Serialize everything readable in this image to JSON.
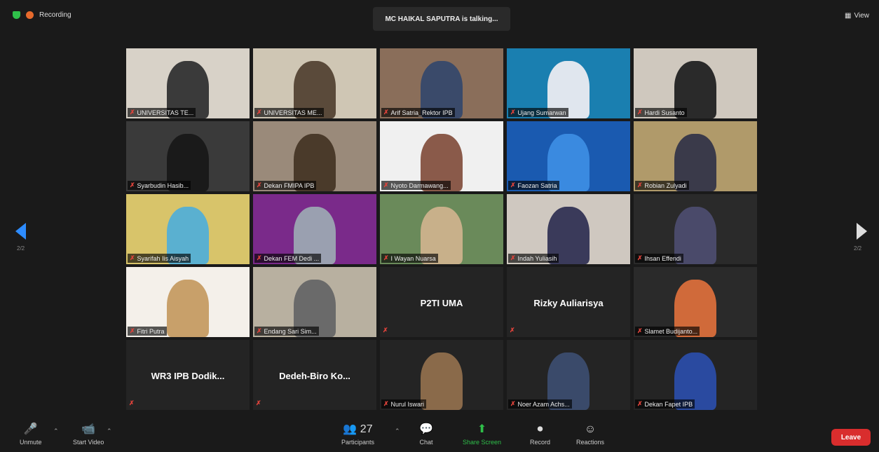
{
  "top": {
    "recording": "Recording",
    "talking": "MC HAIKAL SAPUTRA is talking...",
    "view": "View"
  },
  "page_indicator": {
    "left": "2/2",
    "right": "2/2"
  },
  "tiles": [
    {
      "name": "UNIVERSITAS TE...",
      "bg": "#d8d2c8",
      "fg": "#3a3a3a"
    },
    {
      "name": "UNIVERSITAS ME...",
      "bg": "#cfc6b4",
      "fg": "#5a4a3a"
    },
    {
      "name": "Arif Satria_Rektor IPB",
      "bg": "#8a6e5a",
      "fg": "#3a4a6a"
    },
    {
      "name": "Ujang Sumarwan",
      "bg": "#1a7fb0",
      "fg": "#e0e6ee"
    },
    {
      "name": "Hardi Susanto",
      "bg": "#cfc8be",
      "fg": "#2a2a2a"
    },
    {
      "name": "Syarbudin Hasib...",
      "bg": "#3a3a3a",
      "fg": "#1a1a1a"
    },
    {
      "name": "Dekan FMIPA IPB",
      "bg": "#9a8a7a",
      "fg": "#4a3a2a"
    },
    {
      "name": "Nyoto Darmawang...",
      "bg": "#f0f0f0",
      "fg": "#8a5a4a"
    },
    {
      "name": "Faozan Satria",
      "bg": "#1a5ab0",
      "fg": "#3a8ae0"
    },
    {
      "name": "Robian Zulyadi",
      "bg": "#b09a6a",
      "fg": "#3a3a4a"
    },
    {
      "name": "Syarifah Iis Aisyah",
      "bg": "#d8c46a",
      "fg": "#5ab0d0"
    },
    {
      "name": "Dekan FEM Dedi ...",
      "bg": "#7a2a8a",
      "fg": "#9aa0b0"
    },
    {
      "name": "I Wayan Nuarsa",
      "bg": "#6a8a5a",
      "fg": "#c8b08a"
    },
    {
      "name": "Indah Yuliasih",
      "bg": "#cfc8c0",
      "fg": "#3a3a5a"
    },
    {
      "name": "Ihsan Effendi",
      "bg": "#2a2a2a",
      "fg": "#4a4a6a"
    },
    {
      "name": "Fitri Putra",
      "bg": "#f4f0ea",
      "fg": "#c8a06a"
    },
    {
      "name": "Endang Sari Sim...",
      "bg": "#b8b0a0",
      "fg": "#6a6a6a"
    },
    {
      "name": "P2TI UMA",
      "big": true
    },
    {
      "name": "Rizky Auliarisya",
      "big": true
    },
    {
      "name": "Slamet Budijanto...",
      "bg": "#2a2a2a",
      "fg": "#d06a3a"
    },
    {
      "name": "WR3 IPB Dodik...",
      "big": true
    },
    {
      "name": "Dedeh-Biro Ko...",
      "big": true
    },
    {
      "name": "Nurul Iswari",
      "bg": "#242424",
      "fg": "#8a6a4a"
    },
    {
      "name": "Noer Azam Achs...",
      "bg": "#242424",
      "fg": "#3a4a6a"
    },
    {
      "name": "Dekan Fapet IPB",
      "bg": "#242424",
      "fg": "#2a4aa0"
    }
  ],
  "controls": [
    {
      "key": "unmute",
      "label": "Unmute",
      "icon": "mic-muted-icon",
      "glyph": "🎤"
    },
    {
      "key": "start_video",
      "label": "Start Video",
      "icon": "video-off-icon",
      "glyph": "📹"
    },
    {
      "key": "participants",
      "label": "Participants",
      "icon": "participants-icon",
      "glyph": "👥",
      "count": "27"
    },
    {
      "key": "chat",
      "label": "Chat",
      "icon": "chat-icon",
      "glyph": "💬"
    },
    {
      "key": "share_screen",
      "label": "Share Screen",
      "icon": "share-screen-icon",
      "glyph": "⬆",
      "color": "#2fbf4a"
    },
    {
      "key": "record",
      "label": "Record",
      "icon": "record-icon",
      "glyph": "⏺"
    },
    {
      "key": "reactions",
      "label": "Reactions",
      "icon": "reactions-icon",
      "glyph": "☺"
    }
  ],
  "leave_label": "Leave"
}
